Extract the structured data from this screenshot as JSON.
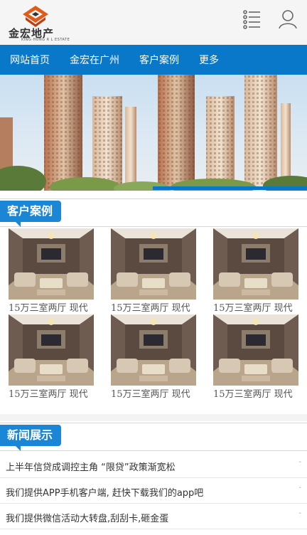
{
  "header": {
    "logo_text": "金宏地产",
    "logo_sub": "KING·HUNG R L ESTATE",
    "menu_icon": "list-menu-icon",
    "user_icon": "user-icon"
  },
  "nav": {
    "items": [
      {
        "label": "网站首页"
      },
      {
        "label": "金宏在广州"
      },
      {
        "label": "客户案例"
      },
      {
        "label": "更多"
      }
    ]
  },
  "cases": {
    "heading": "客户案例",
    "items": [
      {
        "caption": "15万三室两厅 现代"
      },
      {
        "caption": "15万三室两厅 现代"
      },
      {
        "caption": "15万三室两厅 现代"
      },
      {
        "caption": "15万三室两厅 现代"
      },
      {
        "caption": "15万三室两厅 现代"
      },
      {
        "caption": "15万三室两厅 现代"
      }
    ]
  },
  "news": {
    "heading": "新闻展示",
    "items": [
      {
        "title": "上半年信贷成调控主角 “限贷”政策渐宽松",
        "mark": "-"
      },
      {
        "title": "我们提供APP手机客户端, 赶快下载我们的app吧",
        "mark": "-"
      },
      {
        "title": "我们提供微信活动大转盘,刮刮卡,砸金蛋",
        "mark": "-"
      }
    ]
  },
  "colors": {
    "nav_bg": "#0a78c8",
    "tag_bg": "#1b86d6",
    "logo_orange": "#e05a1a"
  }
}
